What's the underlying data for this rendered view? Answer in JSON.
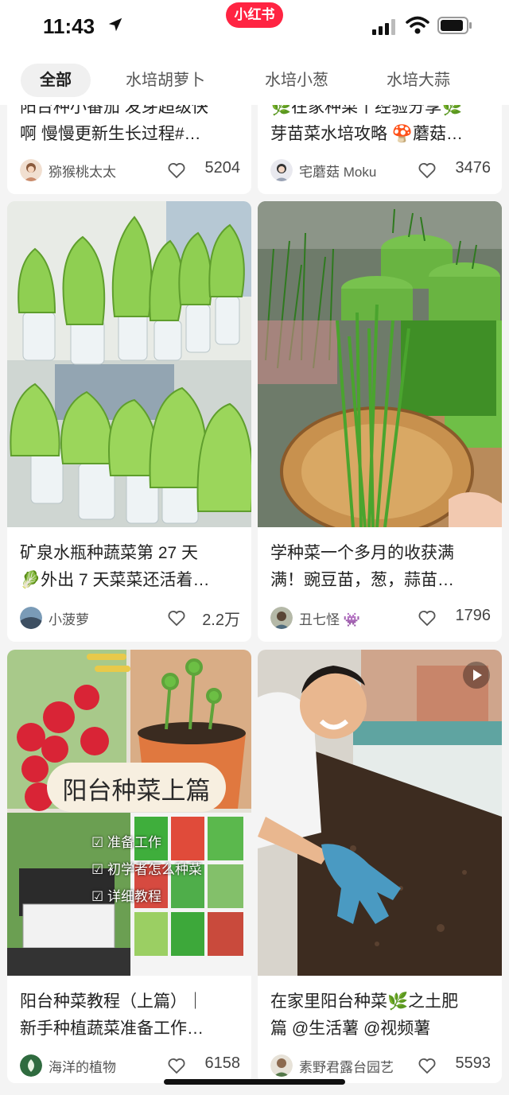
{
  "status_bar": {
    "time": "11:43",
    "brand": "小红书"
  },
  "tabs": [
    "全部",
    "水培胡萝卜",
    "水培小葱",
    "水培大蒜"
  ],
  "cards": [
    {
      "title_line1": "阳台种小番茄 发芽超级快",
      "title_line2": "啊 慢慢更新生长过程#…",
      "author": "猕猴桃太太",
      "likes": "5204"
    },
    {
      "title_line1": "🌿在家种菜丨经验分享🌿",
      "title_line2": "芽苗菜水培攻略 🍄蘑菇…",
      "author": "宅蘑菇 Moku",
      "likes": "3476"
    },
    {
      "title_line1": "矿泉水瓶种蔬菜第 27 天",
      "title_line2": "🥬外出 7 天菜菜还活着…",
      "author": "小菠萝",
      "likes": "2.2万"
    },
    {
      "title_line1": "学种菜一个多月的收获满",
      "title_line2": "满！豌豆苗，葱，蒜苗…",
      "author": "丑七怪 👾",
      "likes": "1796"
    },
    {
      "title_line1": "阳台种菜教程（上篇）｜",
      "title_line2": "新手种植蔬菜准备工作…",
      "author": "海洋的植物",
      "likes": "6158",
      "overlay": {
        "heading": "阳台种菜上篇",
        "items": [
          "☑ 准备工作",
          "☑ 初学者怎么种菜",
          "☑ 详细教程"
        ]
      }
    },
    {
      "title_line1": "在家里阳台种菜🌿之土肥",
      "title_line2": "篇 @生活薯 @视频薯",
      "author": "素野君露台园艺",
      "likes": "5593"
    }
  ],
  "icons": [
    "location-arrow-icon",
    "signal-icon",
    "wifi-icon",
    "battery-icon",
    "heart-icon",
    "video-play-icon"
  ],
  "colors": {
    "brand": "#ff2442",
    "background": "#f4f4f4"
  }
}
